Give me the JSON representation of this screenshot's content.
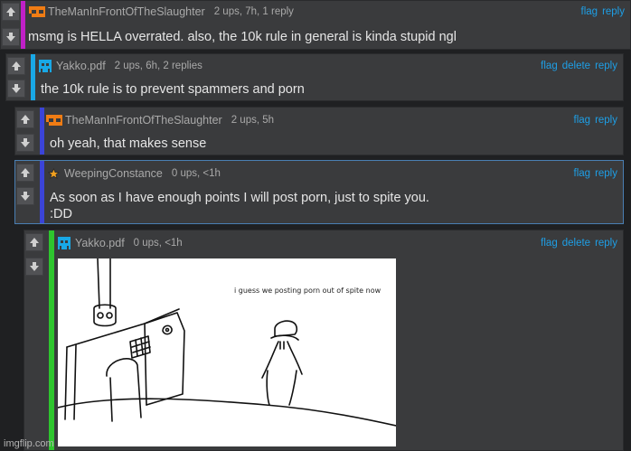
{
  "comments": [
    {
      "username": "TheManInFrontOfTheSlaughter",
      "meta": "2 ups, 7h, 1 reply",
      "text": "msmg is HELLA overrated. also, the 10k rule in general is kinda stupid ngl",
      "actions": [
        "flag",
        "reply"
      ],
      "bar_color": "#c020c8",
      "avatar": "orange-bracket-avatar"
    },
    {
      "username": "Yakko.pdf",
      "meta": "2 ups, 6h, 2 replies",
      "text": "the 10k rule is to prevent spammers and porn",
      "actions": [
        "flag",
        "delete",
        "reply"
      ],
      "bar_color": "#19a8e6",
      "avatar": "blue-invader-avatar"
    },
    {
      "username": "TheManInFrontOfTheSlaughter",
      "meta": "2 ups, 5h",
      "text": "oh yeah, that makes sense",
      "actions": [
        "flag",
        "reply"
      ],
      "bar_color": "#3b44d8",
      "avatar": "orange-bracket-avatar"
    },
    {
      "username": "WeepingConstance",
      "meta": "0 ups, <1h",
      "text": "As soon as I have enough points I will post porn, just to spite you.\n:DD",
      "actions": [
        "flag",
        "reply"
      ],
      "bar_color": "#3b44d8",
      "avatar": "star-avatar"
    },
    {
      "username": "Yakko.pdf",
      "meta": "0 ups, <1h",
      "text": "",
      "actions": [
        "flag",
        "delete",
        "reply"
      ],
      "bar_color": "#2ec52e",
      "avatar": "blue-invader-avatar"
    }
  ],
  "image_caption": "i guess we posting porn out of spite now",
  "watermark": "imgflip.com",
  "colors": {
    "link": "#1e9fe6",
    "comment_bg": "#3a3b3d",
    "page_bg": "#1f2022"
  }
}
